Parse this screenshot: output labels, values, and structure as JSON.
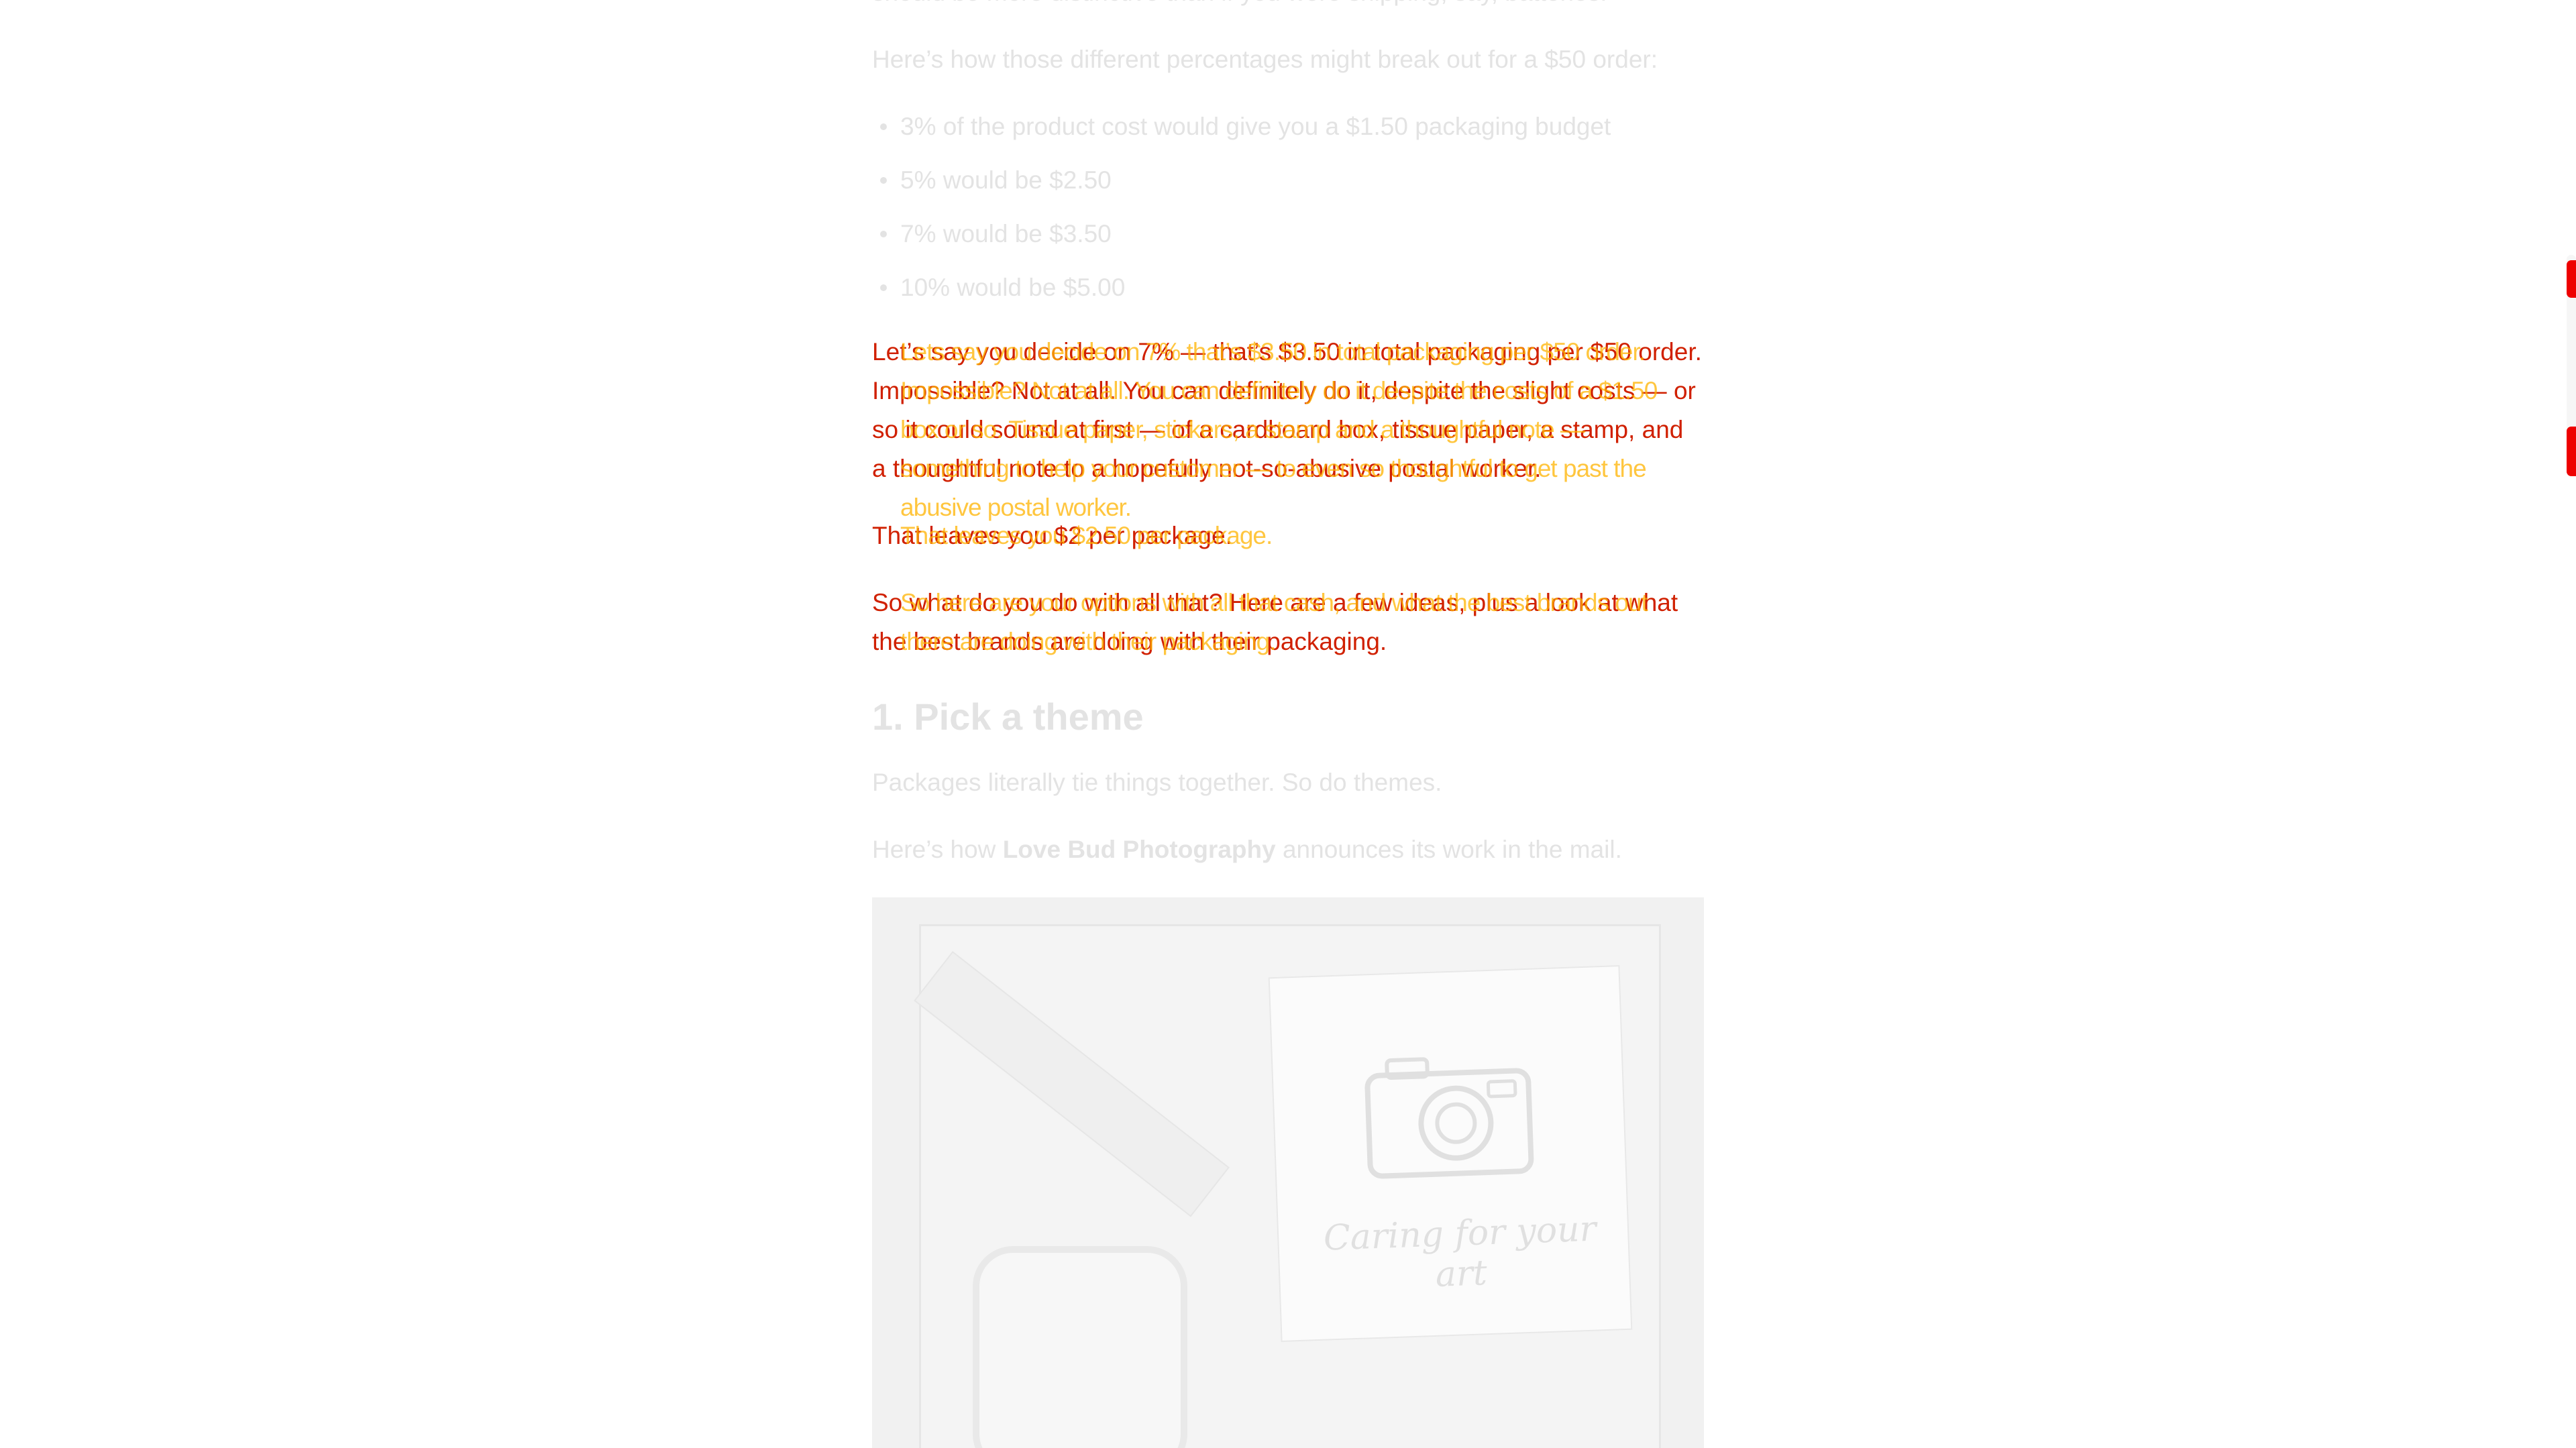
{
  "article": {
    "intro_line": "should be more distinctive than if you were shipping, say, batteries.",
    "breakdown_intro": "Here’s how those different percentages might break out for a $50 order:",
    "bullets": [
      "3% of the product cost would give you a $1.50 packaging budget",
      "5% would be $2.50",
      "7% would be $3.50",
      "10% would be $5.00"
    ],
    "highlight_para_1": "Let’s say you decide on 7% — that’s $3.50 in total packaging per $50 order. Impossible? Not at all. You can definitely do it, despite the slight costs — or so it could sound at first — of a cardboard box, tissue paper, a stamp, and a thoughtful note to a hopefully not-so-abusive postal worker.",
    "highlight_over_1": "Lets say you decide on 7% that’s $3.50 in total packaging per $50 order. Impossible? Not at all. You can definitely do it despite the costs of a $1.50 box or so. Tissue paper, stickers, a stamp and a thoughtful note — something to help your customer — to even so thoughtful to get past the abusive postal worker.",
    "highlight_para_2": "That leaves you $2 per package.",
    "highlight_over_2": "That leaves you $2.50 per package.",
    "highlight_para_3": "So what do you do with all that? Here are a few ideas, plus a look at what the best brands are doing with their packaging.",
    "highlight_over_3": "So here are your options with all that cash, and what the best brands out there are doing with their packaging.",
    "section_heading": "1. Pick a theme",
    "theme_para": "Packages literally tie things together. So do themes.",
    "example_prefix": "Here’s how ",
    "example_brand": "Love Bud Photography",
    "example_suffix": " announces its work in the mail.",
    "image_card_text": "Caring for your art"
  },
  "colors": {
    "faded_text": "#e3e3e3",
    "highlight_red": "#d02000",
    "highlight_orange": "#ffb300",
    "scroll_marker": "#ee0000"
  }
}
